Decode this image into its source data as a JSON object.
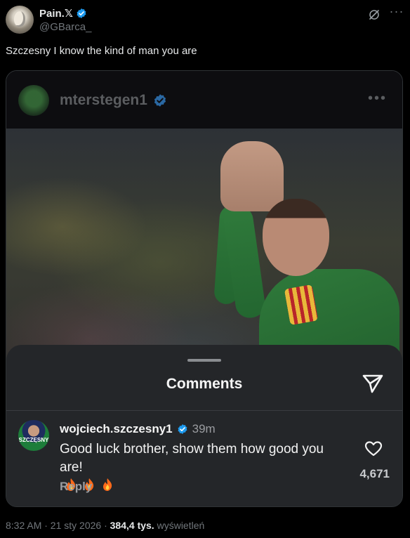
{
  "tweet": {
    "display_name": "Pain.𝕏",
    "handle": "@GBarca_",
    "text": "Szczesny I know the kind of man you are"
  },
  "embedded_post": {
    "username": "mterstegen1",
    "comments_sheet": {
      "title": "Comments",
      "comment": {
        "username": "wojciech.szczesny1",
        "time": "39m",
        "text": "Good luck brother, show them how good you are!",
        "emoji_count": 3,
        "reply_label": "Reply",
        "likes": "4,671",
        "avatar_text": "SZCZĘSNY"
      }
    }
  },
  "footer": {
    "timestamp": "8:32 AM · 21 sty 2026 · ",
    "views": "384,4 tys.",
    "views_label": " wyświetleń"
  },
  "icons": {
    "verified": "verified-badge-icon",
    "grok": "grok-icon",
    "more": "more-icon",
    "send": "send-icon",
    "heart": "heart-icon",
    "fire": "fire-emoji-icon"
  },
  "colors": {
    "verified_blue": "#1d9bf0",
    "background": "#000000",
    "sheet": "#242629"
  }
}
